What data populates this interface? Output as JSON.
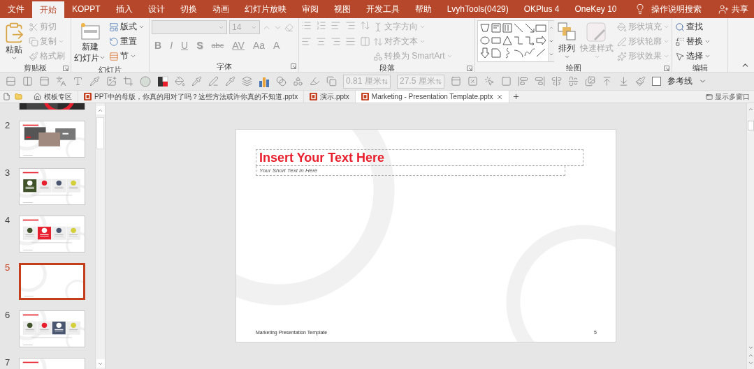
{
  "menu_tabs": [
    {
      "label": "文件",
      "selected": false
    },
    {
      "label": "开始",
      "selected": true
    },
    {
      "label": "KOPPT",
      "selected": false
    },
    {
      "label": "插入",
      "selected": false
    },
    {
      "label": "设计",
      "selected": false
    },
    {
      "label": "切换",
      "selected": false
    },
    {
      "label": "动画",
      "selected": false
    },
    {
      "label": "幻灯片放映",
      "selected": false
    },
    {
      "label": "审阅",
      "selected": false
    },
    {
      "label": "视图",
      "selected": false
    },
    {
      "label": "开发工具",
      "selected": false
    },
    {
      "label": "帮助",
      "selected": false
    },
    {
      "label": "LvyhTools(0429)",
      "selected": false
    },
    {
      "label": "OKPlus 4",
      "selected": false
    },
    {
      "label": "OneKey 10",
      "selected": false
    }
  ],
  "tell_me": "操作说明搜索",
  "share": "共享",
  "ribbon": {
    "clipboard": {
      "label": "剪贴板",
      "paste": "粘贴",
      "items": [
        {
          "label": "剪切",
          "disabled": true
        },
        {
          "label": "复制",
          "disabled": true
        },
        {
          "label": "格式刷",
          "disabled": true
        }
      ]
    },
    "slides": {
      "label": "幻灯片",
      "new_slide": [
        "新建",
        "幻灯片"
      ],
      "items": [
        {
          "label": "版式",
          "disabled": false
        },
        {
          "label": "重置",
          "disabled": false
        },
        {
          "label": "节",
          "disabled": false
        }
      ]
    },
    "font": {
      "label": "字体",
      "size": "14",
      "disabled": true,
      "format_buttons": [
        {
          "label": "B",
          "kind": "bold"
        },
        {
          "label": "I",
          "kind": "italic"
        },
        {
          "label": "U",
          "kind": "underline"
        },
        {
          "label": "S",
          "kind": "shadow"
        },
        {
          "label": "abc",
          "kind": "strike"
        },
        {
          "label": "AV",
          "kind": "spacing"
        },
        {
          "label": "Aa",
          "kind": "case"
        },
        {
          "label": "A",
          "kind": "color"
        }
      ]
    },
    "paragraph": {
      "label": "段落",
      "items": [
        {
          "label": "文字方向",
          "disabled": true
        },
        {
          "label": "对齐文本",
          "disabled": true
        },
        {
          "label": "转换为 SmartArt",
          "disabled": true
        }
      ]
    },
    "drawing": {
      "label": "绘图",
      "arrange": "排列",
      "quick_styles": "快速样式",
      "items": [
        {
          "label": "形状填充",
          "disabled": true
        },
        {
          "label": "形状轮廓",
          "disabled": true
        },
        {
          "label": "形状效果",
          "disabled": true
        }
      ]
    },
    "editing": {
      "label": "编辑",
      "items": [
        {
          "label": "查找",
          "kind": "find"
        },
        {
          "label": "替换",
          "kind": "replace"
        },
        {
          "label": "选择",
          "kind": "select"
        }
      ]
    }
  },
  "quick_toolbar": {
    "height": "0.81 厘米",
    "width": "27.5 厘米",
    "guides": {
      "label": "参考线",
      "checked": false
    }
  },
  "doc_tabs": [
    {
      "label": "模板专区",
      "kind": "home",
      "selected": false
    },
    {
      "label": "PPT中的母版，你真的用对了吗？这些方法或许你真的不知道.pptx",
      "kind": "file",
      "selected": false
    },
    {
      "label": "演示.pptx",
      "kind": "file",
      "selected": false
    },
    {
      "label": "Marketing - Presentation Template.pptx",
      "kind": "file",
      "selected": true
    }
  ],
  "multi_window": "显示多窗口",
  "thumbnails": [
    {
      "kind": "cover",
      "selected": false
    },
    {
      "number": "2",
      "kind": "photos",
      "selected": false
    },
    {
      "number": "3",
      "kind": "cards",
      "selected": false,
      "cards": [
        {
          "color": "#3f5228",
          "filled": true
        },
        {
          "color": "#e8202e",
          "filled": false
        },
        {
          "color": "#4a5670",
          "filled": false
        },
        {
          "color": "#d4cf3a",
          "filled": false
        }
      ]
    },
    {
      "number": "4",
      "kind": "cards",
      "selected": false,
      "cards": [
        {
          "color": "#3f5228",
          "filled": false
        },
        {
          "color": "#e8202e",
          "filled": true
        },
        {
          "color": "#4a5670",
          "filled": false
        },
        {
          "color": "#d4cf3a",
          "filled": false
        }
      ]
    },
    {
      "number": "5",
      "kind": "blank",
      "selected": true
    },
    {
      "number": "6",
      "kind": "cards",
      "selected": false,
      "cards": [
        {
          "color": "#3f5228",
          "filled": false
        },
        {
          "color": "#e8202e",
          "filled": false
        },
        {
          "color": "#4a5670",
          "filled": true
        },
        {
          "color": "#d4cf3a",
          "filled": false
        }
      ]
    },
    {
      "number": "7",
      "kind": "title_only",
      "selected": false
    }
  ],
  "slide": {
    "title": "Insert Your Text Here",
    "subtitle": "Your Short Text In Here",
    "footer": "Marketing Presentation Template",
    "page": "5"
  }
}
